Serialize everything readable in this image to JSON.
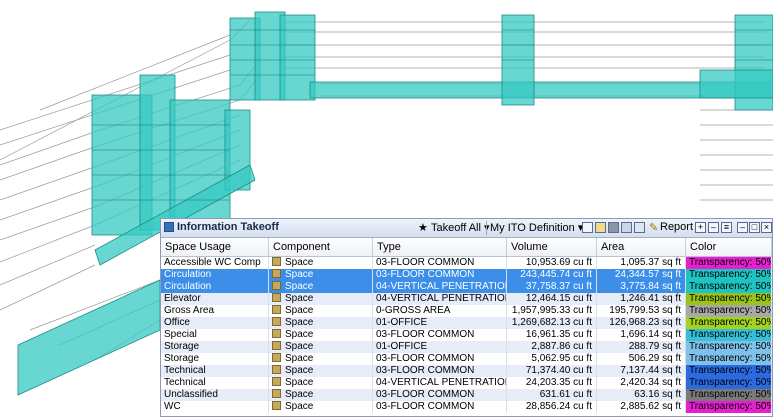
{
  "toolbar": {
    "title": "Information Takeoff",
    "takeoff_all": "Takeoff All",
    "definition": "My ITO Definition",
    "report": "Report"
  },
  "columns": [
    "Space Usage",
    "Component",
    "Type",
    "Volume",
    "Area",
    "Color"
  ],
  "rows": [
    {
      "usage": "Accessible WC Comp",
      "component": "Space",
      "type": "03-FLOOR COMMON",
      "volume": "10,953.69 cu ft",
      "area": "1,095.37 sq ft",
      "color": "Transparency: 50%",
      "swatch": "#e81fd0",
      "state": "plain"
    },
    {
      "usage": "Circulation",
      "component": "Space",
      "type": "03-FLOOR COMMON",
      "volume": "243,445.74 cu ft",
      "area": "24,344.57 sq ft",
      "color": "Transparency: 50%",
      "swatch": "#1ec4c2",
      "state": "sel"
    },
    {
      "usage": "Circulation",
      "component": "Space",
      "type": "04-VERTICAL PENETRATION",
      "volume": "37,758.37 cu ft",
      "area": "3,775.84 sq ft",
      "color": "Transparency: 50%",
      "swatch": "#1ec4c2",
      "state": "sel"
    },
    {
      "usage": "Elevator",
      "component": "Space",
      "type": "04-VERTICAL PENETRATION",
      "volume": "12,464.15 cu ft",
      "area": "1,246.41 sq ft",
      "color": "Transparency: 50%",
      "swatch": "#9ac21a",
      "state": "alt"
    },
    {
      "usage": "Gross Area",
      "component": "Space",
      "type": "0-GROSS AREA",
      "volume": "1,957,995.33 cu ft",
      "area": "195,799.53 sq ft",
      "color": "Transparency: 50%",
      "swatch": "#a8a8a8",
      "state": "plain"
    },
    {
      "usage": "Office",
      "component": "Space",
      "type": "01-OFFICE",
      "volume": "1,269,682.13 cu ft",
      "area": "126,968.23 sq ft",
      "color": "Transparency: 50%",
      "swatch": "#a4d21e",
      "state": "alt"
    },
    {
      "usage": "Special",
      "component": "Space",
      "type": "03-FLOOR COMMON",
      "volume": "16,961.35 cu ft",
      "area": "1,696.14 sq ft",
      "color": "Transparency: 50%",
      "swatch": "#35c0d8",
      "state": "plain"
    },
    {
      "usage": "Storage",
      "component": "Space",
      "type": "01-OFFICE",
      "volume": "2,887.86 cu ft",
      "area": "288.79 sq ft",
      "color": "Transparency: 50%",
      "swatch": "#7fc1ea",
      "state": "alt"
    },
    {
      "usage": "Storage",
      "component": "Space",
      "type": "03-FLOOR COMMON",
      "volume": "5,062.95 cu ft",
      "area": "506.29 sq ft",
      "color": "Transparency: 50%",
      "swatch": "#7fc1ea",
      "state": "plain"
    },
    {
      "usage": "Technical",
      "component": "Space",
      "type": "03-FLOOR COMMON",
      "volume": "71,374.40 cu ft",
      "area": "7,137.44 sq ft",
      "color": "Transparency: 50%",
      "swatch": "#2c6ae0",
      "state": "alt"
    },
    {
      "usage": "Technical",
      "component": "Space",
      "type": "04-VERTICAL PENETRATION",
      "volume": "24,203.35 cu ft",
      "area": "2,420.34 sq ft",
      "color": "Transparency: 50%",
      "swatch": "#2c6ae0",
      "state": "plain"
    },
    {
      "usage": "Unclassified",
      "component": "Space",
      "type": "03-FLOOR COMMON",
      "volume": "631.61 cu ft",
      "area": "63.16 sq ft",
      "color": "Transparency: 50%",
      "swatch": "#7a7a7a",
      "state": "alt"
    },
    {
      "usage": "WC",
      "component": "Space",
      "type": "03-FLOOR COMMON",
      "volume": "28,856.24 cu ft",
      "area": "2,885.62 sq ft",
      "color": "Transparency: 50%",
      "swatch": "#e81fd0",
      "state": "plain"
    }
  ]
}
